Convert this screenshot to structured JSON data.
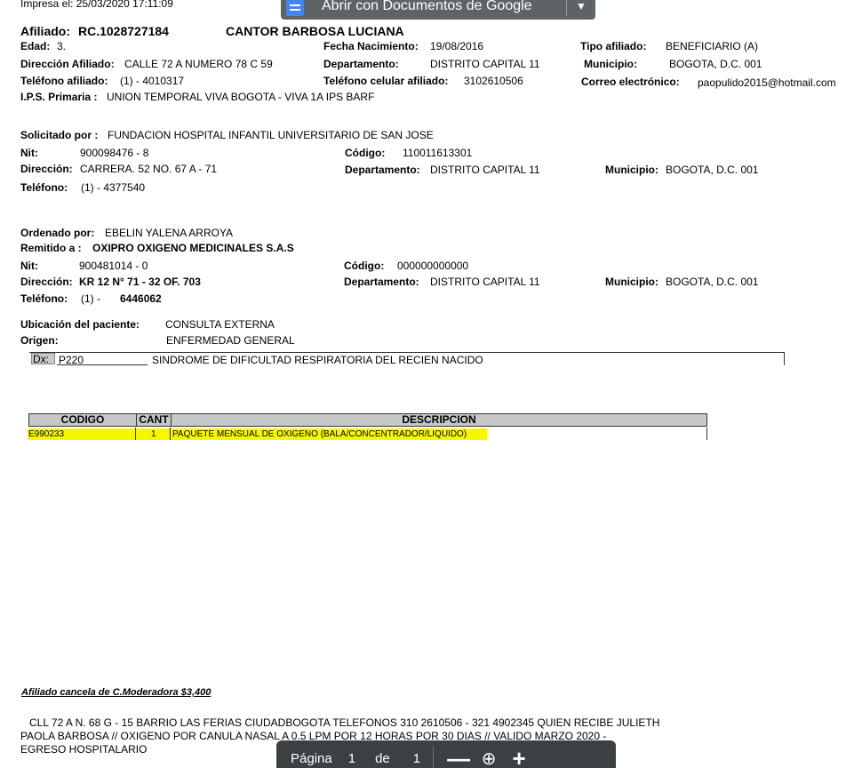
{
  "viewer": {
    "open_with_label": "Abrir con Documentos de Google",
    "page_label": "Página",
    "page_current": "1",
    "page_of": "de",
    "page_total": "1",
    "zoom_out": "—",
    "zoom_in": "+"
  },
  "header": {
    "printed": "Impresa   el: 25/03/2020 17:11:09",
    "afiliado_label": "Afiliado:",
    "afiliado_id": "RC.1028727184",
    "afiliado_name": "CANTOR BARBOSA LUCIANA"
  },
  "patient": {
    "edad_label": "Edad:",
    "edad": "3.",
    "fecha_nac_label": "Fecha Nacimiento:",
    "fecha_nac": "19/08/2016",
    "tipo_label": "Tipo afiliado:",
    "tipo": "BENEFICIARIO  (A)",
    "direccion_label": "Dirección Afiliado:",
    "direccion": "CALLE 72 A NUMERO 78 C 59",
    "depto_label": "Departamento:",
    "depto": "DISTRITO CAPITAL  11",
    "municipio_label": "Municipio:",
    "municipio": "BOGOTA, D.C.  001",
    "telefono_label": "Teléfono afiliado:",
    "telefono": "(1)      -  4010317",
    "celular_label": "Teléfono celular afiliado:",
    "celular": "3102610506",
    "correo_label": "Correo electrónico:",
    "correo": "paopulido2015@hotmail.com",
    "ips_label": "I.P.S. Primaria :",
    "ips": "UNION TEMPORAL VIVA BOGOTA - VIVA 1A IPS BARF"
  },
  "solicitado": {
    "label": "Solicitado por :",
    "nombre": "FUNDACION HOSPITAL INFANTIL UNIVERSITARIO DE SAN JOSE",
    "nit_label": "Nit:",
    "nit": "900098476 - 8",
    "codigo_label": "Código:",
    "codigo": "110011613301",
    "direccion_label": "Dirección:",
    "direccion": "CARRERA. 52 NO. 67 A - 71",
    "depto_label": "Departamento:",
    "depto": "DISTRITO CAPITAL  11",
    "municipio_label": "Municipio:",
    "municipio": "BOGOTA, D.C.  001",
    "telefono_label": "Teléfono:",
    "telefono": "(1)      -  4377540"
  },
  "ordenado": {
    "label": "Ordenado por:",
    "nombre": "EBELIN YALENA ARROYA",
    "remitido_label": "Remitido a :",
    "remitido": "OXIPRO OXIGENO MEDICINALES S.A.S",
    "nit_label": "Nit:",
    "nit": "900481014 - 0",
    "codigo_label": "Código:",
    "codigo": "000000000000",
    "direccion_label": "Dirección:",
    "direccion": "KR 12 N° 71 - 32 OF. 703",
    "depto_label": "Departamento:",
    "depto": "DISTRITO CAPITAL  11",
    "municipio_label": "Municipio:",
    "municipio": "BOGOTA, D.C.  001",
    "telefono_label": "Teléfono:",
    "telefono_pre": "(1)   -",
    "telefono": "6446062"
  },
  "ubicacion": {
    "label": "Ubicación del paciente:",
    "value": "CONSULTA EXTERNA",
    "origen_label": "Origen:",
    "origen": "ENFERMEDAD GENERAL"
  },
  "dx": {
    "label": "Dx:",
    "code": "P220",
    "desc": "SINDROME DE DIFICULTAD RESPIRATORIA DEL RECIEN NACIDO"
  },
  "table": {
    "headers": [
      "CODIGO",
      "CANT",
      "DESCRIPCION"
    ],
    "rows": [
      {
        "codigo": "E990233",
        "cant": "1",
        "descripcion": "PAQUETE MENSUAL DE OXIGENO (BALA/CONCENTRADOR/LIQUIDO)"
      }
    ]
  },
  "footer": {
    "moderadora": "Afiliado cancela de C.Moderadora      $3,400",
    "nota_1": "CLL 72 A N. 68 G - 15 BARRIO LAS FERIAS CIUDADBOGOTA  TELEFONOS 310 2610506 - 321 4902345 QUIEN RECIBE JULIETH",
    "nota_2": "PAOLA BARBOSA // OXIGENO POR CANULA NASAL A  0.5 LPM POR 12  HORAS POR 30  DIAS   // VALIDO MARZO  2020 -",
    "nota_3": "EGRESO HOSPITALARIO"
  },
  "colors": {
    "highlight": "#f7f700",
    "table_header": "#c8c8c8",
    "toolbar": "#5f6368",
    "pager": "#3c4043",
    "docs_blue": "#4285f4"
  }
}
